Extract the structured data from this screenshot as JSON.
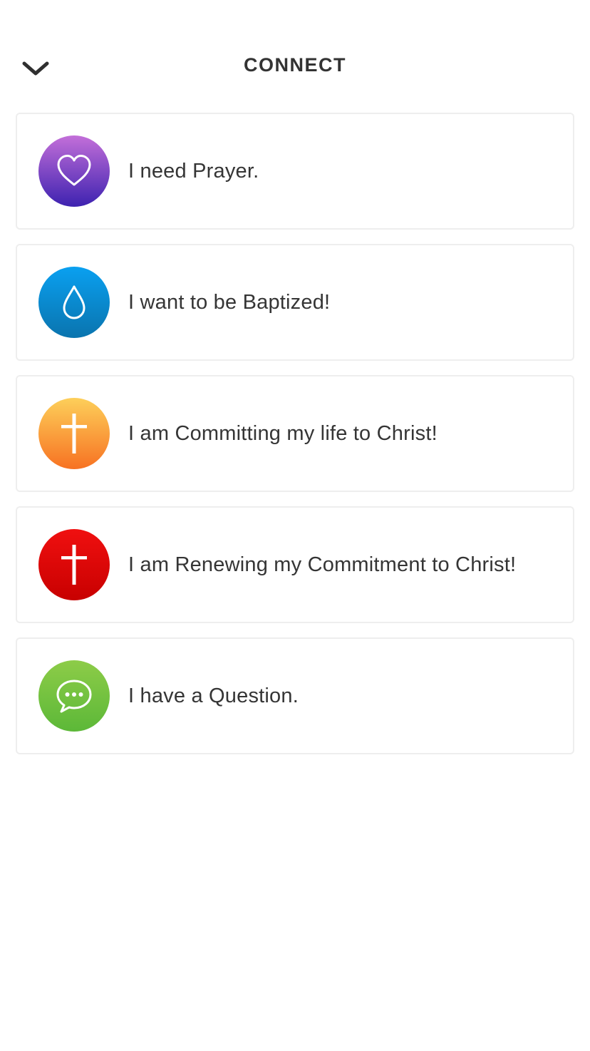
{
  "header": {
    "title": "CONNECT",
    "collapse_icon": "chevron-down-icon"
  },
  "options": [
    {
      "label": "I need Prayer.",
      "icon": "heart-icon",
      "color_top": "#c36fd9",
      "color_bottom": "#3d22b0"
    },
    {
      "label": "I want to be Baptized!",
      "icon": "water-drop-icon",
      "color_top": "#0aa0f0",
      "color_bottom": "#0a74ae"
    },
    {
      "label": "I am Committing my life to Christ!",
      "icon": "cross-icon",
      "color_top": "#fdcf5a",
      "color_bottom": "#f77222"
    },
    {
      "label": "I am Renewing my Commitment to Christ!",
      "icon": "cross-icon",
      "color_top": "#f01010",
      "color_bottom": "#c80000"
    },
    {
      "label": "I have a Question.",
      "icon": "chat-bubble-icon",
      "color_top": "#8dcc48",
      "color_bottom": "#5cb838"
    }
  ]
}
